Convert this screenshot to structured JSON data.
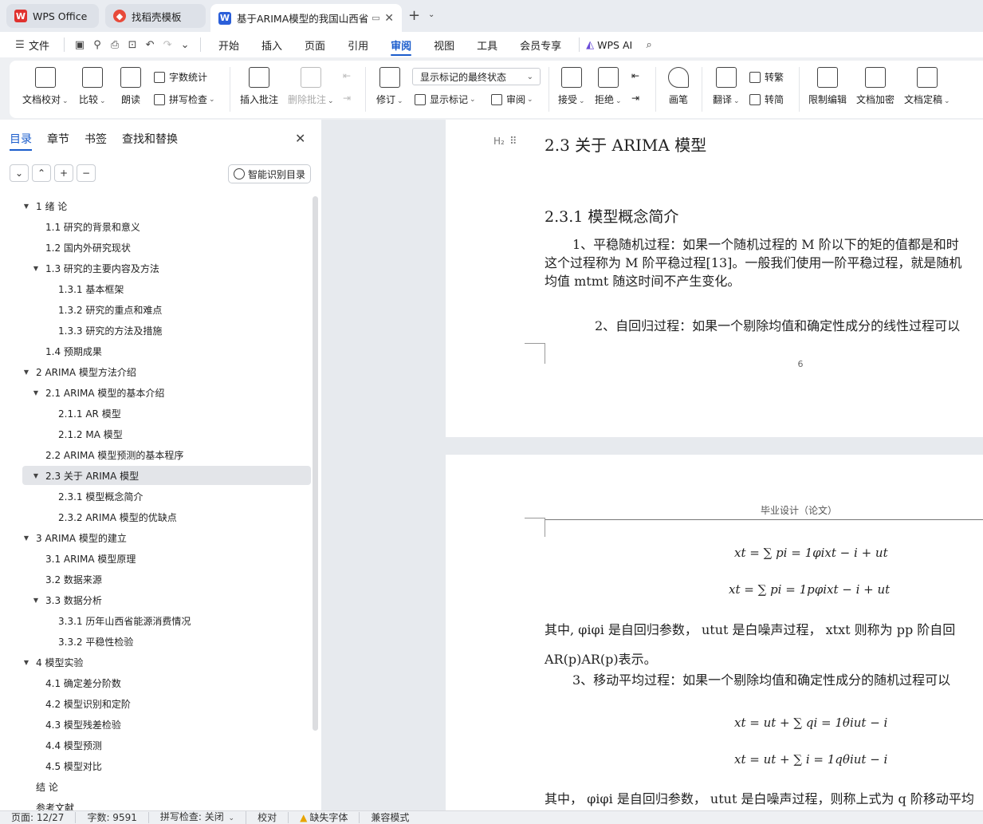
{
  "tabs": [
    {
      "label": "WPS Office",
      "icon": "wps-logo-icon"
    },
    {
      "label": "找稻壳模板",
      "icon": "docer-logo-icon"
    },
    {
      "label": "基于ARIMA模型的我国山西省",
      "icon": "writer-doc-icon",
      "badge": "W"
    }
  ],
  "menu": {
    "file": "文件",
    "tabs": [
      "开始",
      "插入",
      "页面",
      "引用",
      "审阅",
      "视图",
      "工具",
      "会员专享"
    ],
    "active_tab": "审阅",
    "ai": "WPS AI"
  },
  "ribbon": {
    "doc_proof": "文档校对",
    "compare": "比较",
    "read_aloud": "朗读",
    "word_count": "字数统计",
    "spell_check": "拼写检查",
    "insert_comment": "插入批注",
    "delete_comment": "删除批注",
    "revise": "修订",
    "markup_mode": "显示标记的最终状态",
    "show_markup": "显示标记",
    "review_pane": "审阅",
    "accept": "接受",
    "reject": "拒绝",
    "pen": "画笔",
    "translate": "翻译",
    "to_traditional": "转繁",
    "to_simplified": "转简",
    "restrict_edit": "限制编辑",
    "encrypt": "文档加密",
    "finalize": "文档定稿"
  },
  "sidebar": {
    "tabs": [
      "目录",
      "章节",
      "书签",
      "查找和替换"
    ],
    "active_tab": "目录",
    "smart_toc": "智能识别目录",
    "toc": [
      {
        "level": 1,
        "label": "1  绪  论",
        "expanded": true
      },
      {
        "level": 2,
        "label": "1.1  研究的背景和意义"
      },
      {
        "level": 2,
        "label": "1.2  国内外研究现状"
      },
      {
        "level": 2,
        "label": "1.3  研究的主要内容及方法",
        "expanded": true
      },
      {
        "level": 3,
        "label": "1.3.1  基本框架"
      },
      {
        "level": 3,
        "label": "1.3.2  研究的重点和难点"
      },
      {
        "level": 3,
        "label": "1.3.3  研究的方法及措施"
      },
      {
        "level": 2,
        "label": "1.4  预期成果"
      },
      {
        "level": 1,
        "label": "2 ARIMA 模型方法介绍",
        "expanded": true
      },
      {
        "level": 2,
        "label": "2.1 ARIMA 模型的基本介绍",
        "expanded": true
      },
      {
        "level": 3,
        "label": "2.1.1 AR 模型"
      },
      {
        "level": 3,
        "label": "2.1.2 MA 模型"
      },
      {
        "level": 2,
        "label": "2.2 ARIMA 模型预测的基本程序"
      },
      {
        "level": 2,
        "label": "2.3 关于 ARIMA 模型",
        "expanded": true,
        "selected": true
      },
      {
        "level": 3,
        "label": "2.3.1  模型概念简介"
      },
      {
        "level": 3,
        "label": "2.3.2 ARIMA 模型的优缺点"
      },
      {
        "level": 1,
        "label": "3 ARIMA 模型的建立",
        "expanded": true
      },
      {
        "level": 2,
        "label": "3.1 ARIMA 模型原理"
      },
      {
        "level": 2,
        "label": "3.2  数据来源"
      },
      {
        "level": 2,
        "label": "3.3  数据分析",
        "expanded": true
      },
      {
        "level": 3,
        "label": "3.3.1  历年山西省能源消费情况"
      },
      {
        "level": 3,
        "label": "3.3.2  平稳性检验"
      },
      {
        "level": 1,
        "label": "4  模型实验",
        "expanded": true
      },
      {
        "level": 2,
        "label": "4.1 确定差分阶数"
      },
      {
        "level": 2,
        "label": "4.2  模型识别和定阶"
      },
      {
        "level": 2,
        "label": "4.3  模型残差检验"
      },
      {
        "level": 2,
        "label": "4.4  模型预测"
      },
      {
        "level": 2,
        "label": "4.5  模型对比"
      },
      {
        "level": 1,
        "label": "结  论"
      },
      {
        "level": 1,
        "label": "参考文献"
      }
    ]
  },
  "document": {
    "page1": {
      "h2_tag": "H₂",
      "heading": "2.3 关于 ARIMA 模型",
      "subheading": "2.3.1  模型概念简介",
      "para1_line1": "1、平稳随机过程：如果一个随机过程的 M 阶以下的矩的值都是和时",
      "para1_line2": "这个过程称为 M 阶平稳过程[13]。一般我们使用一阶平稳过程，就是随机",
      "para1_line3": "均值 mtmt 随这时间不产生变化。",
      "para2_line1": "2、自回归过程：如果一个剔除均值和确定性成分的线性过程可以",
      "page_number": "6"
    },
    "page2": {
      "header": "毕业设计（论文）",
      "formula1": "xt = ∑ pi = 1φixt − i + ut",
      "formula2": "xt = ∑ pi = 1pφixt − i + ut",
      "para1_line1": "其中, φiφi 是自回归参数， utut 是白噪声过程， xtxt 则称为 pp 阶自回",
      "para1_line2": "AR(p)AR(p)表示。",
      "para2_line1": "3、移动平均过程：如果一个剔除均值和确定性成分的随机过程可以",
      "formula3": "xt = ut + ∑ qi = 1θiut − i",
      "formula4": "xt = ut + ∑ i = 1qθiut − i",
      "para3_line1": "其中， φiφi 是自回归参数， utut 是白噪声过程，则称上式为 q 阶移动平均"
    }
  },
  "status": {
    "page": "页面: 12/27",
    "words": "字数: 9591",
    "spell": "拼写检查: 关闭",
    "proof": "校对",
    "missing_font": "缺失字体",
    "compat": "兼容模式"
  },
  "colors": {
    "accent": "#1a5ccc",
    "wps_red": "#e0322f",
    "writer_blue": "#2b5fd9"
  }
}
